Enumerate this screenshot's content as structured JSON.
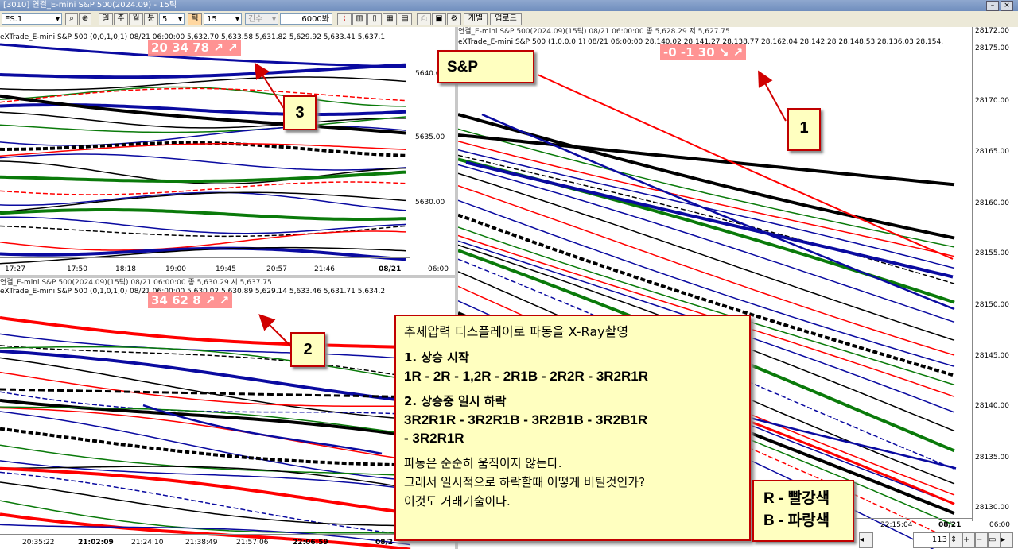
{
  "window": {
    "title": "[3010] 연결_E-mini S&P 500(2024.09) - 15틱"
  },
  "toolbar": {
    "symbol": "ES.1",
    "btn_day": "일",
    "btn_week": "주",
    "btn_month": "월",
    "btn_min": "분",
    "min_value": "5",
    "btn_tick": "틱",
    "tick_value": "15",
    "count_label": "건수",
    "bars_value": "6000봐",
    "btn_each": "개별",
    "btn_upload": "업로드"
  },
  "pane1": {
    "header": "eXTrade_E-mini S&P 500  (0,0,1,0,1) 08/21 06:00:00  5,632.70  5,633.58  5,631.82  5,629.92  5,633.41  5,637.1",
    "pressure": "20  34  78 ↗ ↗",
    "y_labels": [
      "5640.00",
      "5635.00",
      "5630.00"
    ],
    "x_labels": [
      "17:27",
      "17:50",
      "18:18",
      "19:00",
      "19:45",
      "20:57",
      "21:46",
      "08/21",
      "06:00"
    ]
  },
  "pane2": {
    "header_top": "연결_E-mini S&P 500(2024.09)(15틱) 08/21 06:00:00   종 5,630.29  시 5,637.75",
    "header": "eXTrade_E-mini S&P 500  (0,1,0,1,0) 08/21 06:00:00  5,630.02  5,630.89  5,629.14  5,633.46  5,631.71  5,634.2",
    "pressure": "34  62  8 ↗ ↗",
    "x_labels": [
      "20:35:22",
      "21:02:09",
      "21:24:10",
      "21:38:49",
      "21:57:06",
      "22:06:59",
      "08/2"
    ]
  },
  "pane3": {
    "header_top": "연결_E-mini S&P 500(2024.09)(15틱) 08/21 06:00:00   종 5,628.29  저 5,627.75",
    "header": "eXTrade_E-mini S&P 500  (1,0,0,0,1) 08/21 06:00:00  28,140.02  28,141.27  28,138.77  28,162.04  28,142.28  28,148.53  28,136.03  28,154.",
    "pressure": "-0  -1  30 ↘ ↗",
    "y_labels": [
      "28175.00",
      "28170.00",
      "28165.00",
      "28160.00",
      "28155.00",
      "28150.00",
      "28145.00",
      "28140.00",
      "28135.00",
      "28130.00"
    ],
    "top_right_value": "28172.00",
    "x_labels": [
      "22:15:04",
      "08/21",
      "06:00"
    ],
    "scroll_value": "113"
  },
  "callouts": {
    "c1": "1",
    "c2": "2",
    "c3": "3",
    "sp": "S&P"
  },
  "info": {
    "line1": "추세압력 디스플레이로 파동을 X-Ray촬영",
    "h1": "1. 상승 시작",
    "seq1": "1R - 2R - 1,2R - 2R1B - 2R2R - 3R2R1R",
    "h2": "2. 상승중 일시 하락",
    "seq2a": "3R2R1R - 3R2R1B - 3R2B1B - 3R2B1R",
    "seq2b": "- 3R2R1R",
    "p1": "파동은 순순히 움직이지 않는다.",
    "p2": "그래서 일시적으로 하락할때 어떻게 버틸것인가?",
    "p3": "이것도 거래기술이다."
  },
  "legend": {
    "r": "R - 빨강색",
    "b": "B - 파랑색"
  },
  "colors": {
    "red": "#ff0000",
    "blue": "#0a0aa0",
    "green": "#0a7a0a",
    "black": "#000000",
    "callout_bg": "#ffffc0",
    "callout_border": "#c00000"
  }
}
